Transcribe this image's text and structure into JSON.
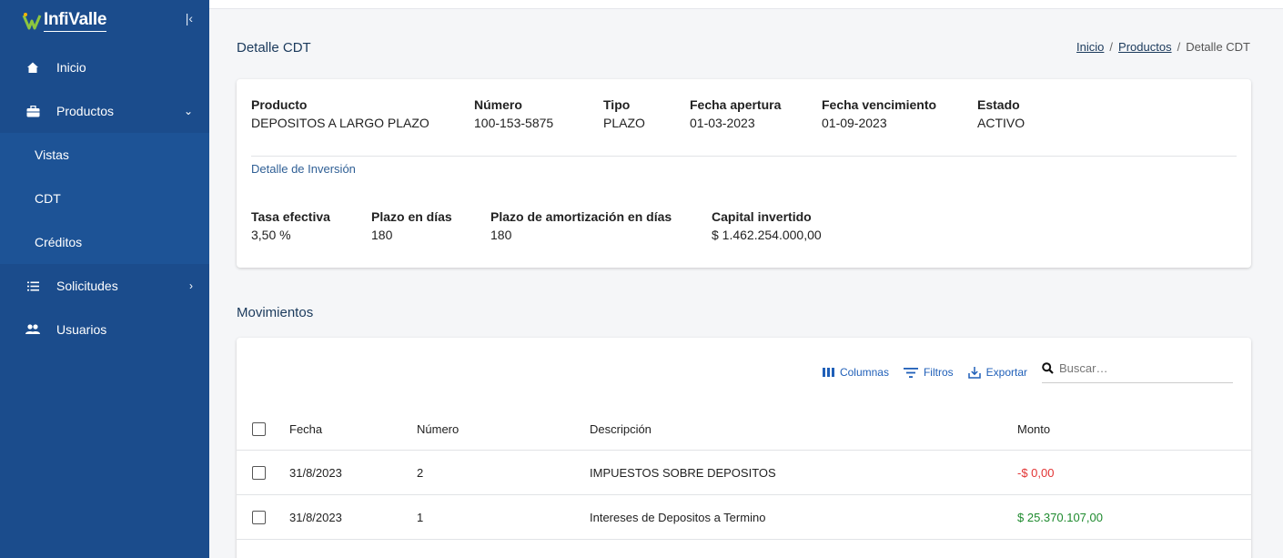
{
  "app": {
    "logo_text": "InfiValle"
  },
  "sidebar": {
    "items": [
      {
        "label": "Inicio",
        "icon": "home-icon"
      },
      {
        "label": "Productos",
        "icon": "briefcase-icon",
        "expanded": true,
        "children": [
          {
            "label": "Vistas"
          },
          {
            "label": "CDT"
          },
          {
            "label": "Créditos"
          }
        ]
      },
      {
        "label": "Solicitudes",
        "icon": "list-icon"
      },
      {
        "label": "Usuarios",
        "icon": "users-icon"
      }
    ]
  },
  "header": {
    "title": "Detalle CDT",
    "breadcrumb": {
      "home": "Inicio",
      "products": "Productos",
      "current": "Detalle CDT",
      "separator": "/"
    }
  },
  "detail": {
    "fields": [
      {
        "label": "Producto",
        "value": "DEPOSITOS A LARGO PLAZO"
      },
      {
        "label": "Número",
        "value": "100-153-5875"
      },
      {
        "label": "Tipo",
        "value": "PLAZO"
      },
      {
        "label": "Fecha apertura",
        "value": "01-03-2023"
      },
      {
        "label": "Fecha vencimiento",
        "value": "01-09-2023"
      },
      {
        "label": "Estado",
        "value": "ACTIVO"
      }
    ],
    "investment_title": "Detalle de Inversión",
    "investment": [
      {
        "label": "Tasa efectiva",
        "value": "3,50 %"
      },
      {
        "label": "Plazo en días",
        "value": "180"
      },
      {
        "label": "Plazo de amortización en días",
        "value": "180"
      },
      {
        "label": "Capital invertido",
        "value": "$ 1.462.254.000,00"
      }
    ]
  },
  "movements": {
    "title": "Movimientos",
    "toolbar": {
      "columns": "Columnas",
      "filters": "Filtros",
      "export": "Exportar",
      "search_placeholder": "Buscar…"
    },
    "columns": {
      "fecha": "Fecha",
      "numero": "Número",
      "descripcion": "Descripción",
      "monto": "Monto"
    },
    "rows": [
      {
        "fecha": "31/8/2023",
        "numero": "2",
        "descripcion": "IMPUESTOS SOBRE DEPOSITOS",
        "monto": "-$ 0,00"
      },
      {
        "fecha": "31/8/2023",
        "numero": "1",
        "descripcion": "Intereses de Depositos a Termino",
        "monto": "$ 25.370.107,00"
      }
    ]
  },
  "colors": {
    "sidebar": "#1b4c8c",
    "accent": "#1f5fb8",
    "negative": "#e23434",
    "positive": "#1e8a2e"
  }
}
